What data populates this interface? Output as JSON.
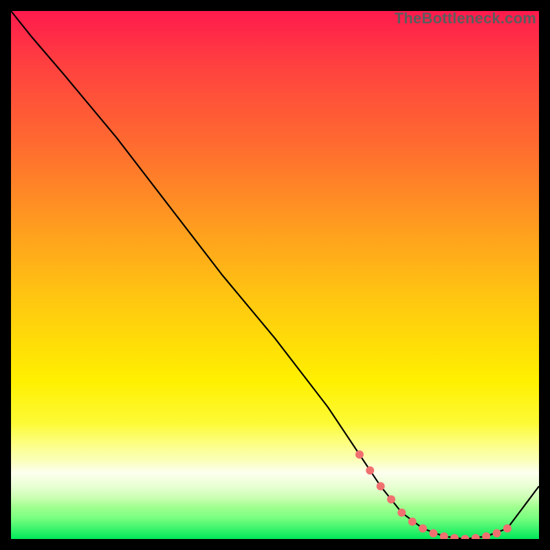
{
  "watermark": "TheBottleneck.com",
  "chart_data": {
    "type": "line",
    "title": "",
    "xlabel": "",
    "ylabel": "",
    "xlim": [
      0,
      100
    ],
    "ylim": [
      0,
      100
    ],
    "grid": false,
    "series": [
      {
        "name": "curve",
        "x": [
          0,
          4,
          10,
          20,
          30,
          40,
          50,
          60,
          66,
          70,
          74,
          78,
          82,
          86,
          90,
          94,
          100
        ],
        "y": [
          100,
          95,
          88,
          76,
          63,
          50,
          38,
          25,
          16,
          10,
          5,
          2,
          0.5,
          0,
          0.5,
          2,
          10
        ]
      }
    ],
    "markers": {
      "name": "highlight-points",
      "color": "#f07070",
      "x": [
        66,
        68,
        70,
        72,
        74,
        76,
        78,
        80,
        82,
        84,
        86,
        88,
        90,
        92,
        94
      ],
      "y": [
        16,
        13,
        10,
        7.5,
        5,
        3.3,
        2,
        1.1,
        0.5,
        0.15,
        0,
        0.15,
        0.5,
        1.1,
        2
      ]
    },
    "background": {
      "type": "vertical-gradient",
      "stops": [
        {
          "pos": 0.0,
          "color": "#ff1a4d"
        },
        {
          "pos": 0.25,
          "color": "#ff6a30"
        },
        {
          "pos": 0.55,
          "color": "#ffc810"
        },
        {
          "pos": 0.82,
          "color": "#fcff50"
        },
        {
          "pos": 0.96,
          "color": "#7aff80"
        },
        {
          "pos": 1.0,
          "color": "#00e85a"
        }
      ]
    }
  }
}
